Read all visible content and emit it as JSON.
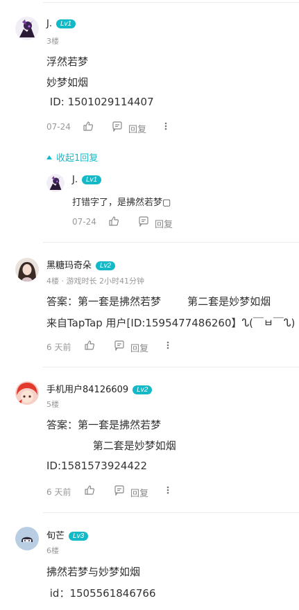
{
  "accent_color": "#14b9c8",
  "comments": [
    {
      "user": "J.",
      "level": "Lv1",
      "floor": "3楼",
      "lines": [
        "浮然若梦",
        "妙梦如烟",
        " ID: 1501029114407"
      ],
      "date": "07-24",
      "reply_label": "回复",
      "collapse_label": "收起1回复",
      "reply": {
        "user": "J.",
        "level": "Lv1",
        "text": "打错字了，是拂然若梦▢",
        "date": "07-24",
        "reply_label": "回复"
      }
    },
    {
      "user": "黑糖玛奇朵",
      "level": "Lv2",
      "floor": "4楼 · 游戏时长 2小时41分钟",
      "lines": [
        "答案：第一套是拂然若梦        第二套是妙梦如烟",
        "来自TapTap 用户[ID:1595477486260】ᔐ(￣ㅂ￣ᔐ)"
      ],
      "date": "6 天前",
      "reply_label": "回复"
    },
    {
      "user": "手机用户84126609",
      "level": "Lv2",
      "floor": "5楼",
      "lines": [
        "答案：第一套是拂然若梦",
        "              第二套是妙梦如烟",
        "ID:1581573924422"
      ],
      "date": "6 天前",
      "reply_label": "回复"
    },
    {
      "user": "旬芒",
      "level": "Lv3",
      "floor": "6楼",
      "lines": [
        "拂然若梦与妙梦如烟",
        " id：1505561846766"
      ]
    }
  ]
}
